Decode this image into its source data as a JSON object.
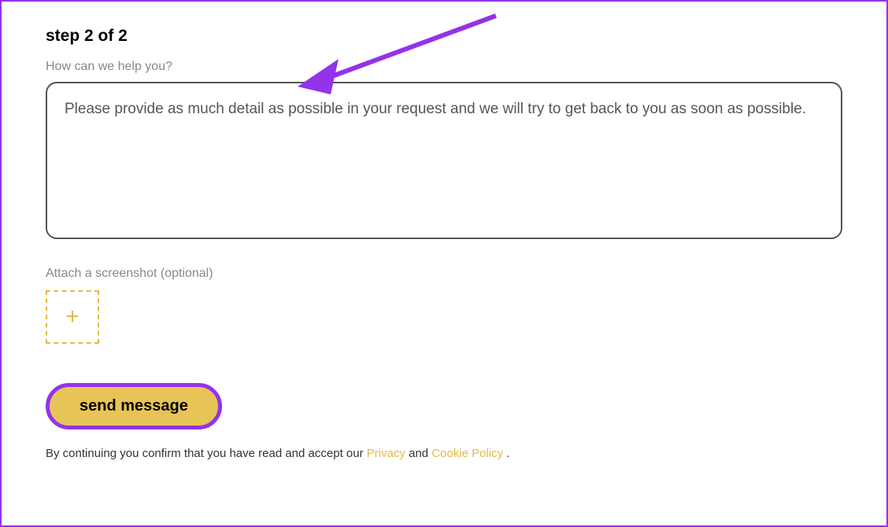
{
  "step": {
    "heading": "step 2 of 2"
  },
  "form": {
    "help_label": "How can we help you?",
    "message_placeholder": "Please provide as much detail as possible in your request and we will try to get back to you as soon as possible.",
    "attach_label": "Attach a screenshot (optional)"
  },
  "button": {
    "send_label": "send message"
  },
  "disclaimer": {
    "prefix": "By continuing you confirm that you have read and accept our ",
    "privacy_label": "Privacy",
    "and": " and ",
    "cookie_label": "Cookie Policy ",
    "suffix": "."
  },
  "colors": {
    "accent_purple": "#9333ea",
    "accent_yellow": "#e8c457",
    "border_yellow": "#e3b947"
  }
}
